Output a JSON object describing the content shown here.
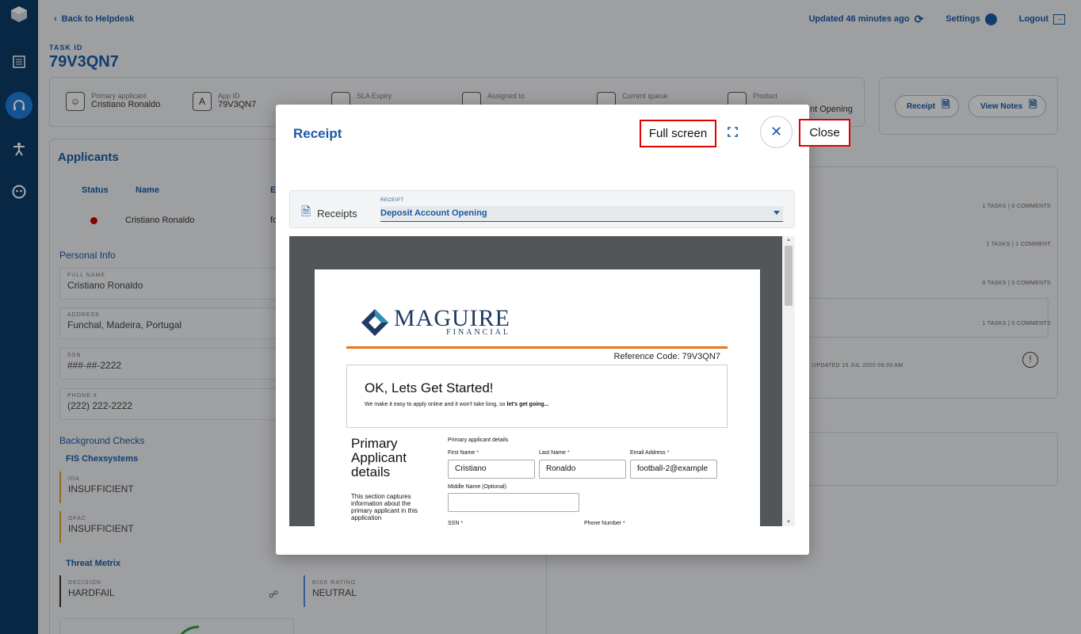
{
  "topbar": {
    "back_label": "Back to Helpdesk",
    "updated_label": "Updated 46 minutes ago",
    "settings_label": "Settings",
    "logout_label": "Logout"
  },
  "task": {
    "id_label": "TASK ID",
    "id_value": "79V3QN7"
  },
  "info": {
    "primary_label": "Primary applicant",
    "primary_value": "Cristiano Ronaldo",
    "app_label": "App ID",
    "app_value": "79V3QN7",
    "sla_label": "SLA Expiry",
    "assigned_label": "Assigned to",
    "queue_label": "Current queue",
    "product_label": "Product",
    "product_value": "nt Opening"
  },
  "actions": {
    "receipt_label": "Receipt",
    "notes_label": "View Notes"
  },
  "applicants": {
    "heading": "Applicants",
    "col_status": "Status",
    "col_name": "Name",
    "col_e": "E",
    "row_name": "Cristiano Ronaldo",
    "row_partial": "fo"
  },
  "personal": {
    "heading": "Personal Info",
    "full_name_label": "FULL NAME",
    "full_name": "Cristiano Ronaldo",
    "address_label": "ADDRESS",
    "address": "Funchal, Madeira, Portugal",
    "ssn_label": "SSN",
    "ssn": "###-##-2222",
    "phone_label": "PHONE #",
    "phone": "(222) 222-2222"
  },
  "background": {
    "heading": "Background Checks",
    "provider": "FIS Chexsystems",
    "ida_label": "IDA",
    "ida_value": "INSUFFICIENT",
    "ofac_label": "OFAC",
    "ofac_value": "INSUFFICIENT",
    "threat_heading": "Threat Metrix",
    "decision_label": "DECISION",
    "decision_value": "HARDFAIL",
    "risk_label": "RISK RATING",
    "risk_value": "NEUTRAL"
  },
  "right_panel": {
    "t1": "1 TASKS | 0 COMMENTS",
    "t2": "1 TASKS | 1 COMMENT",
    "t3": "0 TASKS | 0 COMMENTS",
    "t4": "1 TASKS | 0 COMMENTS",
    "updated": "UPDATED 15 JUL 2020 09:39 AM"
  },
  "modal": {
    "title": "Receipt",
    "fullscreen_label": "Full screen",
    "close_label": "Close",
    "receipts_label": "Receipts",
    "select_label": "RECEIPT",
    "select_value": "Deposit Account Opening"
  },
  "pdf": {
    "brand": "MAGUIRE",
    "brand_sub": "FINANCIAL",
    "reference": "Reference Code: 79V3QN7",
    "start_title": "OK, Lets Get Started!",
    "start_sub": "We make it easy to apply online and it won't take long, so",
    "start_sub_bold": "let's get going...",
    "section_title": "Primary Applicant details",
    "section_desc": "This section captures information about the primary applicant in this application",
    "details_label": "Primary applicant details",
    "first_name_label": "First Name",
    "first_name": "Cristiano",
    "last_name_label": "Last Name",
    "last_name": "Ronaldo",
    "email_label": "Email Address",
    "email": "football-2@example",
    "middle_label": "Middle Name (Optional)",
    "ssn_label": "SSN",
    "phone_label": "Phone Number",
    "req": "*"
  },
  "colors": {
    "rail": "#0d3b66",
    "accent": "#1a5aa6",
    "highlight": "#e00000",
    "brand_orange": "#e8731a"
  }
}
